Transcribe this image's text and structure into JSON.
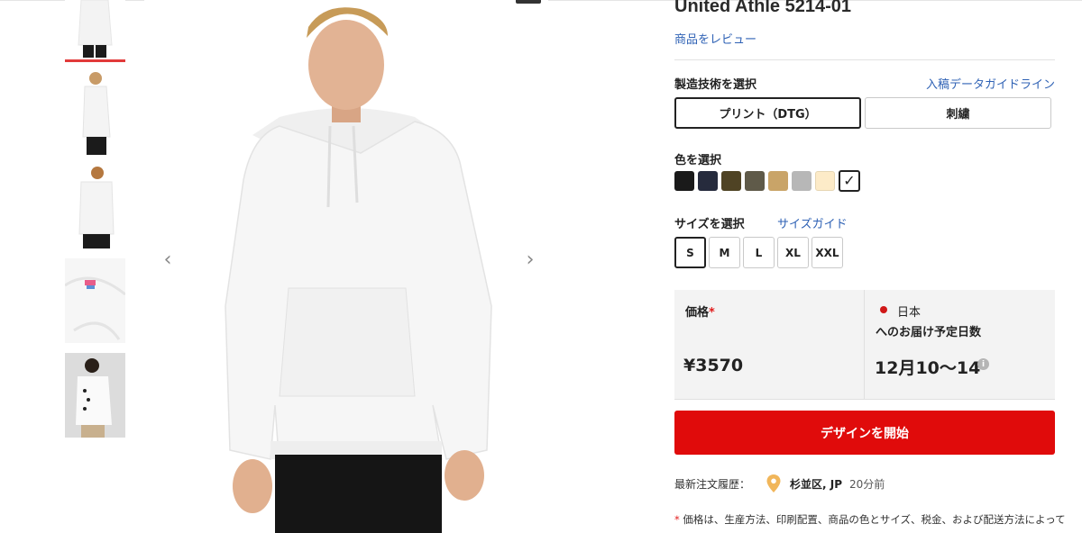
{
  "product": {
    "title": "United Athle 5214-01",
    "review_link": "商品をレビュー"
  },
  "gallery": {
    "thumbnails": [
      "front-model",
      "side-model",
      "back-model",
      "detail-closeup",
      "female-model"
    ],
    "active_index": 0,
    "prev_icon": "chevron-left-icon",
    "next_icon": "chevron-right-icon"
  },
  "technique": {
    "label": "製造技術を選択",
    "guide_link": "入稿データガイドライン",
    "options": [
      "プリント（DTG）",
      "刺繍"
    ],
    "selected": "プリント（DTG）"
  },
  "color": {
    "label": "色を選択",
    "swatches": [
      "#1a1a1a",
      "#262b3d",
      "#4f4324",
      "#5f5a49",
      "#c9a468",
      "#b7b7b7",
      "#fdebc8",
      "#ffffff"
    ],
    "selected_index": 7,
    "check_icon": "✓"
  },
  "size": {
    "label": "サイズを選択",
    "guide_link": "サイズガイド",
    "options": [
      "S",
      "M",
      "L",
      "XL",
      "XXL"
    ],
    "selected": "S"
  },
  "price": {
    "label": "価格",
    "required_mark": "*",
    "value": "¥3570"
  },
  "delivery": {
    "country": "日本",
    "label": "へのお届け予定日数",
    "value": "12月10〜14",
    "info_icon": "i"
  },
  "cta": {
    "label": "デザインを開始"
  },
  "recent_order": {
    "label": "最新注文履歴：",
    "location": "杉並区, JP",
    "time_ago": "20分前"
  },
  "note": {
    "mark": "*",
    "text": " 価格は、生産方法、印刷配置、商品の色とサイズ、税金、および配送方法によって"
  },
  "colors": {
    "accent_red": "#e00b0b",
    "link_blue": "#2f62b5"
  }
}
